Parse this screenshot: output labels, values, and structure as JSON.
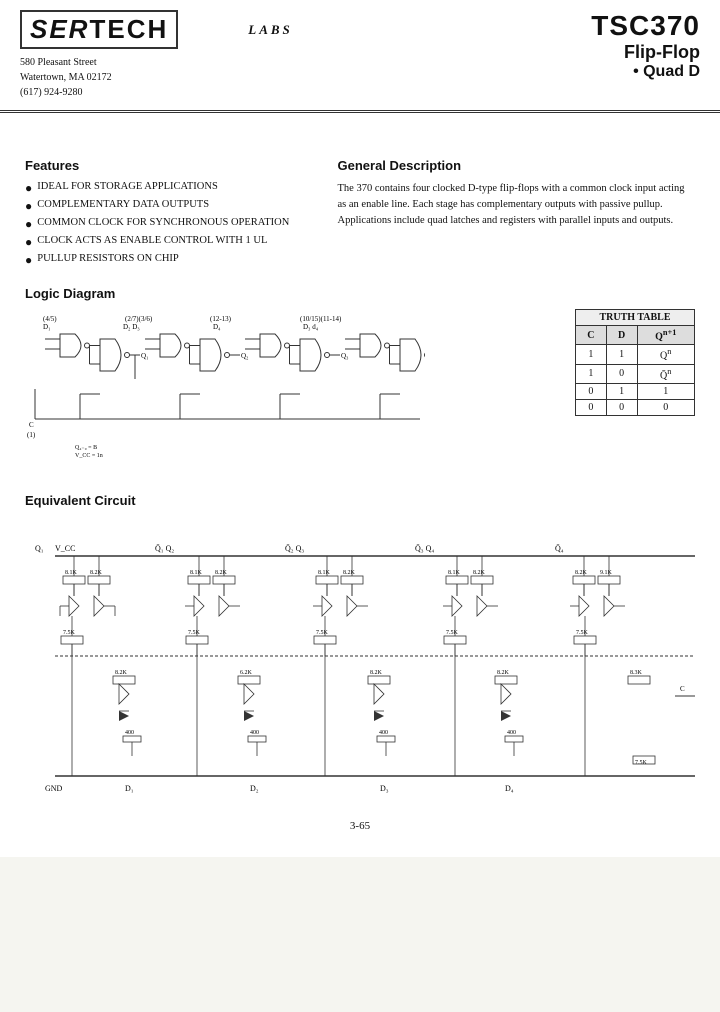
{
  "header": {
    "logo": "SERTECH",
    "labs": "LABS",
    "address_line1": "580 Pleasant Street",
    "address_line2": "Watertown, MA  02172",
    "address_line3": "(617) 924-9280",
    "part_number": "TSC370",
    "part_type": "Flip-Flop",
    "part_variant": "• Quad D"
  },
  "features": {
    "title": "Features",
    "items": [
      "IDEAL FOR STORAGE APPLICATIONS",
      "COMPLEMENTARY DATA OUTPUTS",
      "COMMON CLOCK FOR SYNCHRONOUS OPERATION",
      "CLOCK ACTS AS ENABLE CONTROL WITH 1 UL",
      "PULLUP RESISTORS ON CHIP"
    ]
  },
  "general_description": {
    "title": "General Description",
    "text": "The 370 contains four clocked D-type flip-flops with a common clock input acting as an enable line. Each stage has complementary outputs with passive pullup. Applications include quad latches and registers with parallel inputs and outputs."
  },
  "logic_diagram": {
    "title": "Logic Diagram"
  },
  "truth_table": {
    "title": "TRUTH TABLE",
    "headers": [
      "C",
      "D",
      "Qn+1"
    ],
    "rows": [
      [
        "1",
        "1",
        "Qn"
      ],
      [
        "1",
        "0",
        "Q̄n"
      ],
      [
        "0",
        "1",
        "1"
      ],
      [
        "0",
        "0",
        "0"
      ]
    ]
  },
  "equivalent_circuit": {
    "title": "Equivalent Circuit"
  },
  "page": "3-65"
}
